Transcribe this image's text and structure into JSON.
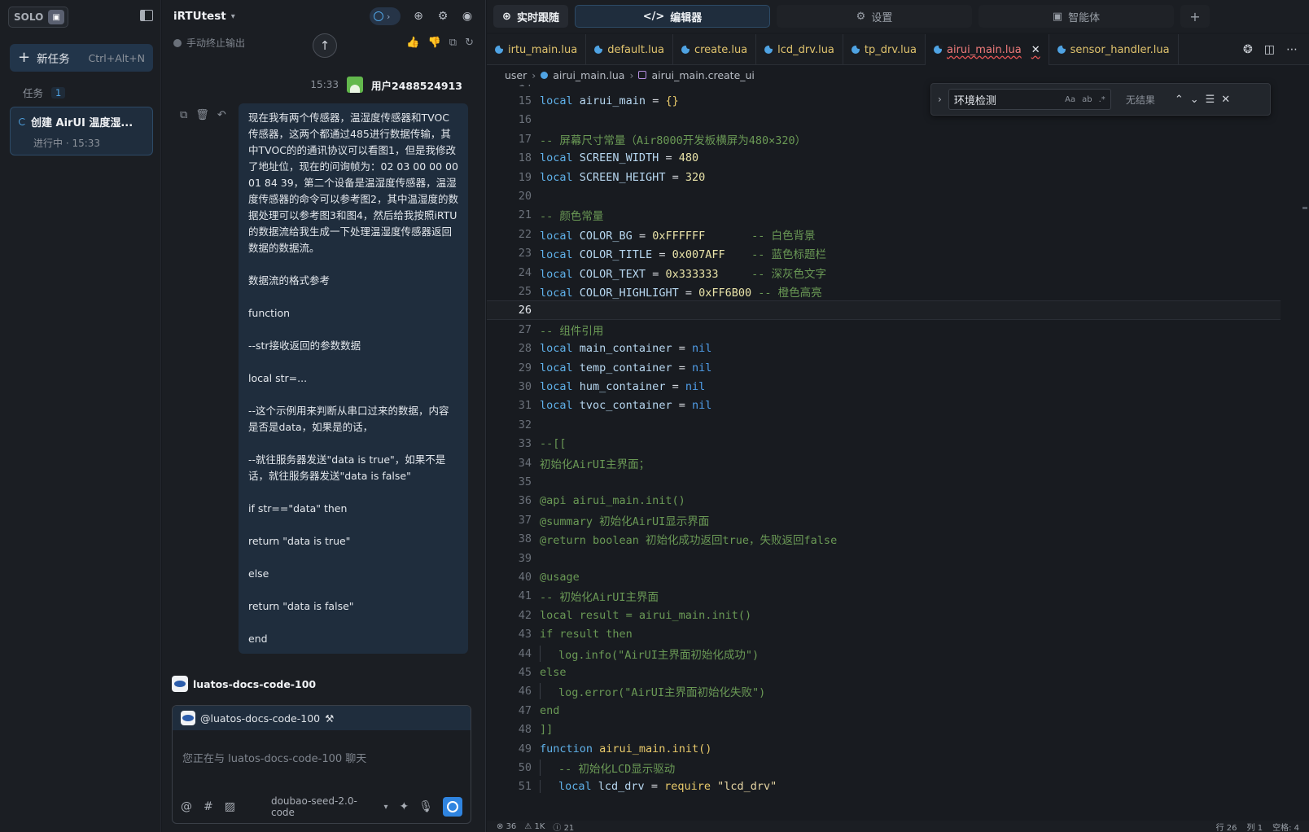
{
  "sidebar": {
    "badge": "SOLO",
    "new_task_label": "新任务",
    "new_task_shortcut": "Ctrl+Alt+N",
    "section_label": "任务",
    "section_count": "1",
    "tasks": [
      {
        "title": "创建 AirUI 温度湿...",
        "status": "进行中 · 15:33"
      }
    ]
  },
  "chat": {
    "project_name": "iRTUtest",
    "stop_output_label": "手动终止输出",
    "user": {
      "time": "15:33",
      "name": "用户2488524913"
    },
    "message_paragraphs": [
      "现在我有两个传感器，温湿度传感器和TVOC传感器，这两个都通过485进行数据传输，其中TVOC的的通讯协议可以看图1，但是我修改了地址位，现在的问询帧为：02 03 00 00 00 01 84 39，第二个设备是温湿度传感器，温湿度传感器的命令可以参考图2，其中温湿度的数据处理可以参考图3和图4，然后给我按照iRTU的数据流给我生成一下处理温湿度传感器返回数据的数据流。",
      "数据流的格式参考",
      "function",
      "--str接收返回的参数数据",
      "local str=...",
      "--这个示例用来判断从串口过来的数据，内容是否是data，如果是的话，",
      "--就往服务器发送\"data is true\"，如果不是话，就往服务器发送\"data is false\"",
      "if str==\"data\" then",
      "return \"data is true\"",
      "else",
      "return \"data is false\"",
      "end"
    ],
    "agent_name": "luatos-docs-code-100",
    "composer": {
      "agent_mention": "@luatos-docs-code-100",
      "placeholder": "您正在与 luatos-docs-code-100 聊天",
      "model": "doubao-seed-2.0-code"
    }
  },
  "editor": {
    "top_tabs": [
      "实时跟随",
      "编辑器",
      "设置",
      "智能体"
    ],
    "add_tab": "+",
    "file_tabs": [
      {
        "name": "irtu_main.lua",
        "active": false
      },
      {
        "name": "default.lua",
        "active": false
      },
      {
        "name": "create.lua",
        "active": false
      },
      {
        "name": "lcd_drv.lua",
        "active": false
      },
      {
        "name": "tp_drv.lua",
        "active": false
      },
      {
        "name": "airui_main.lua",
        "active": true
      },
      {
        "name": "sensor_handler.lua",
        "active": false
      }
    ],
    "breadcrumb": [
      "user",
      "airui_main.lua",
      "airui_main.create_ui"
    ],
    "find": {
      "value": "环境检测",
      "result": "无结果",
      "opt_case": "Aa",
      "opt_word": "ab",
      "opt_regex": ".*"
    },
    "current_line": 26,
    "first_line_partial": "14",
    "lines": [
      {
        "n": 15,
        "tokens": [
          [
            "kw",
            "local "
          ],
          [
            "id",
            "airui_main"
          ],
          [
            "pl",
            " = "
          ],
          [
            "fn",
            "{}"
          ]
        ]
      },
      {
        "n": 16,
        "tokens": []
      },
      {
        "n": 17,
        "tokens": [
          [
            "cm",
            "-- 屏幕尺寸常量（Air8000开发板横屏为480×320）"
          ]
        ]
      },
      {
        "n": 18,
        "tokens": [
          [
            "kw",
            "local "
          ],
          [
            "id",
            "SCREEN_WIDTH"
          ],
          [
            "pl",
            " = "
          ],
          [
            "num",
            "480"
          ]
        ]
      },
      {
        "n": 19,
        "tokens": [
          [
            "kw",
            "local "
          ],
          [
            "id",
            "SCREEN_HEIGHT"
          ],
          [
            "pl",
            " = "
          ],
          [
            "num",
            "320"
          ]
        ]
      },
      {
        "n": 20,
        "tokens": []
      },
      {
        "n": 21,
        "tokens": [
          [
            "cm",
            "-- 颜色常量"
          ]
        ]
      },
      {
        "n": 22,
        "tokens": [
          [
            "kw",
            "local "
          ],
          [
            "id",
            "COLOR_BG"
          ],
          [
            "pl",
            " = "
          ],
          [
            "num",
            "0xFFFFFF"
          ],
          [
            "cm",
            "       -- 白色背景"
          ]
        ]
      },
      {
        "n": 23,
        "tokens": [
          [
            "kw",
            "local "
          ],
          [
            "id",
            "COLOR_TITLE"
          ],
          [
            "pl",
            " = "
          ],
          [
            "num",
            "0x007AFF"
          ],
          [
            "cm",
            "    -- 蓝色标题栏"
          ]
        ]
      },
      {
        "n": 24,
        "tokens": [
          [
            "kw",
            "local "
          ],
          [
            "id",
            "COLOR_TEXT"
          ],
          [
            "pl",
            " = "
          ],
          [
            "num",
            "0x333333"
          ],
          [
            "cm",
            "     -- 深灰色文字"
          ]
        ]
      },
      {
        "n": 25,
        "tokens": [
          [
            "kw",
            "local "
          ],
          [
            "id",
            "COLOR_HIGHLIGHT"
          ],
          [
            "pl",
            " = "
          ],
          [
            "num",
            "0xFF6B00"
          ],
          [
            "cm",
            " -- 橙色高亮"
          ]
        ]
      },
      {
        "n": 26,
        "tokens": []
      },
      {
        "n": 27,
        "tokens": [
          [
            "cm",
            "-- 组件引用"
          ]
        ]
      },
      {
        "n": 28,
        "tokens": [
          [
            "kw",
            "local "
          ],
          [
            "id",
            "main_container"
          ],
          [
            "pl",
            " = "
          ],
          [
            "nil",
            "nil"
          ]
        ]
      },
      {
        "n": 29,
        "tokens": [
          [
            "kw",
            "local "
          ],
          [
            "id",
            "temp_container"
          ],
          [
            "pl",
            " = "
          ],
          [
            "nil",
            "nil"
          ]
        ]
      },
      {
        "n": 30,
        "tokens": [
          [
            "kw",
            "local "
          ],
          [
            "id",
            "hum_container"
          ],
          [
            "pl",
            " = "
          ],
          [
            "nil",
            "nil"
          ]
        ]
      },
      {
        "n": 31,
        "tokens": [
          [
            "kw",
            "local "
          ],
          [
            "id",
            "tvoc_container"
          ],
          [
            "pl",
            " = "
          ],
          [
            "nil",
            "nil"
          ]
        ]
      },
      {
        "n": 32,
        "tokens": []
      },
      {
        "n": 33,
        "tokens": [
          [
            "cm",
            "--[["
          ]
        ]
      },
      {
        "n": 34,
        "tokens": [
          [
            "cm",
            "初始化AirUI主界面；"
          ]
        ]
      },
      {
        "n": 35,
        "tokens": []
      },
      {
        "n": 36,
        "tokens": [
          [
            "cm",
            "@api airui_main.init()"
          ]
        ]
      },
      {
        "n": 37,
        "tokens": [
          [
            "cm",
            "@summary 初始化AirUI显示界面"
          ]
        ]
      },
      {
        "n": 38,
        "tokens": [
          [
            "cm",
            "@return boolean 初始化成功返回true，失败返回false"
          ]
        ]
      },
      {
        "n": 39,
        "tokens": []
      },
      {
        "n": 40,
        "tokens": [
          [
            "cm",
            "@usage"
          ]
        ]
      },
      {
        "n": 41,
        "tokens": [
          [
            "cm",
            "-- 初始化AirUI主界面"
          ]
        ]
      },
      {
        "n": 42,
        "tokens": [
          [
            "cm",
            "local result = airui_main.init()"
          ]
        ]
      },
      {
        "n": 43,
        "tokens": [
          [
            "cm",
            "if result then"
          ]
        ]
      },
      {
        "n": 44,
        "indent": 1,
        "tokens": [
          [
            "cm",
            "log.info(\"AirUI主界面初始化成功\")"
          ]
        ]
      },
      {
        "n": 45,
        "tokens": [
          [
            "cm",
            "else"
          ]
        ]
      },
      {
        "n": 46,
        "indent": 1,
        "tokens": [
          [
            "cm",
            "log.error(\"AirUI主界面初始化失败\")"
          ]
        ]
      },
      {
        "n": 47,
        "tokens": [
          [
            "cm",
            "end"
          ]
        ]
      },
      {
        "n": 48,
        "tokens": [
          [
            "cm",
            "]]"
          ]
        ]
      },
      {
        "n": 49,
        "tokens": [
          [
            "kw",
            "function "
          ],
          [
            "fn",
            "airui_main.init()"
          ]
        ]
      },
      {
        "n": 50,
        "indent": 1,
        "tokens": [
          [
            "cm",
            "-- 初始化LCD显示驱动"
          ]
        ]
      },
      {
        "n": 51,
        "indent": 1,
        "tokens": [
          [
            "kw",
            "local "
          ],
          [
            "id",
            "lcd_drv"
          ],
          [
            "pl",
            " = "
          ],
          [
            "fn",
            "require "
          ],
          [
            "str",
            "\"lcd_drv\""
          ]
        ]
      }
    ],
    "status": {
      "errors": "36",
      "warnings": "1K",
      "info": "21",
      "row": "行 26",
      "col": "列 1",
      "spaces": "空格: 4"
    }
  },
  "colors": {
    "accent": "#2f84e0",
    "selected_bg": "#1f2d3d",
    "comment": "#6a9955",
    "keyword": "#5fb0e8"
  }
}
